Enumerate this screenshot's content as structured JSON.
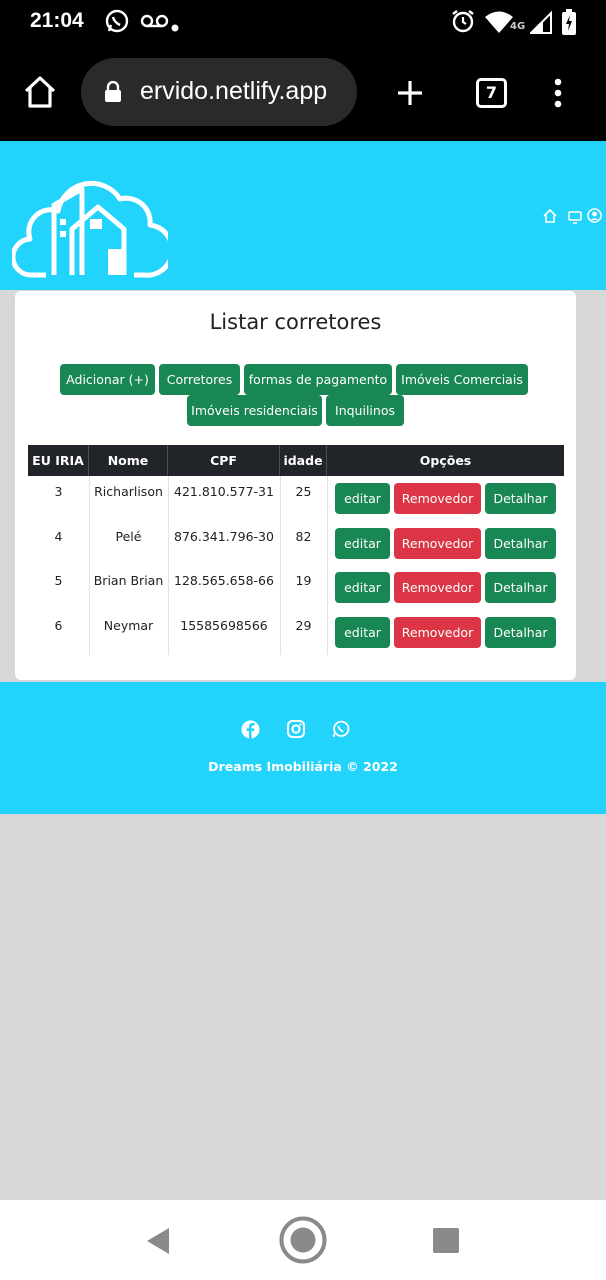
{
  "status_bar": {
    "time": "21:04",
    "network": "4G",
    "icons": [
      "whatsapp-icon",
      "voicemail-icon",
      "alarm-icon",
      "wifi-icon",
      "signal-icon",
      "battery-icon"
    ]
  },
  "browser": {
    "url": "ervido.netlify.app",
    "tab_count": "7"
  },
  "header": {
    "icons": [
      "home-icon",
      "monitor-icon",
      "user-icon"
    ]
  },
  "card": {
    "title": "Listar corretores",
    "nav_buttons": [
      "Adicionar (+)",
      "Corretores",
      "formas de pagamento",
      "Imóveis Comerciais",
      "Imóveis residenciais",
      "Inquilinos"
    ]
  },
  "table": {
    "headers": [
      "EU IRIA",
      "Nome",
      "CPF",
      "idade",
      "Opções"
    ],
    "rows": [
      {
        "id": "3",
        "name": "Richarlison",
        "cpf": "421.810.577-31",
        "age": "25"
      },
      {
        "id": "4",
        "name": "Pelé",
        "cpf": "876.341.796-30",
        "age": "82"
      },
      {
        "id": "5",
        "name": "Brian Brian",
        "cpf": "128.565.658-66",
        "age": "19"
      },
      {
        "id": "6",
        "name": "Neymar",
        "cpf": "15585698566",
        "age": "29"
      }
    ],
    "actions": {
      "edit": "editar",
      "remove": "Removedor",
      "detail": "Detalhar"
    }
  },
  "footer": {
    "text": "Dreams Imobiliária © 2022",
    "icons": [
      "facebook-icon",
      "instagram-icon",
      "whatsapp-icon"
    ]
  },
  "colors": {
    "header": "#22d3fb",
    "button_green": "#198754",
    "button_red": "#dc3545",
    "table_header": "#212529"
  }
}
